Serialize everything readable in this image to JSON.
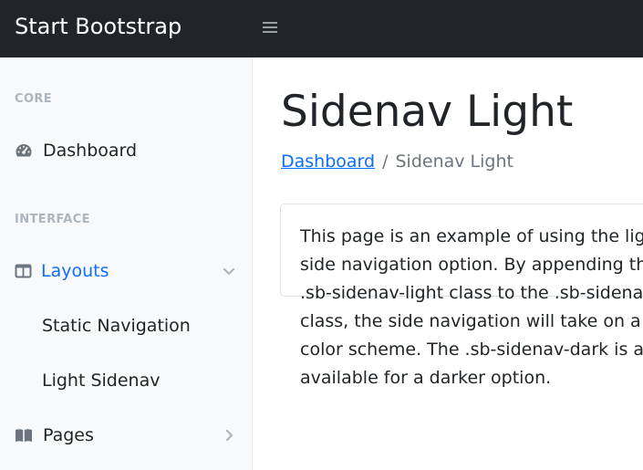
{
  "topnav": {
    "brand": "Start Bootstrap",
    "toggle_icon": "hamburger-menu-icon"
  },
  "sidenav": {
    "core_heading": "CORE",
    "dashboard_label": "Dashboard",
    "interface_heading": "INTERFACE",
    "layouts_label": "Layouts",
    "layouts_expanded": true,
    "layouts_items": [
      {
        "label": "Static Navigation"
      },
      {
        "label": "Light Sidenav"
      }
    ],
    "pages_label": "Pages",
    "pages_expanded": false
  },
  "main": {
    "title": "Sidenav Light",
    "breadcrumb": {
      "link": "Dashboard",
      "separator": "/",
      "current": "Sidenav Light"
    },
    "card_text": "This page is an example of using the light side navigation option. By appending the .sb-sidenav-light class to the .sb-sidenav class, the side navigation will take on a light color scheme. The .sb-sidenav-dark is also available for a darker option."
  },
  "colors": {
    "topnav_bg": "#212529",
    "sidenav_bg": "#f8f9fa",
    "accent": "#0d6efd",
    "heading": "#adb5bd",
    "icon": "#6c757d"
  }
}
